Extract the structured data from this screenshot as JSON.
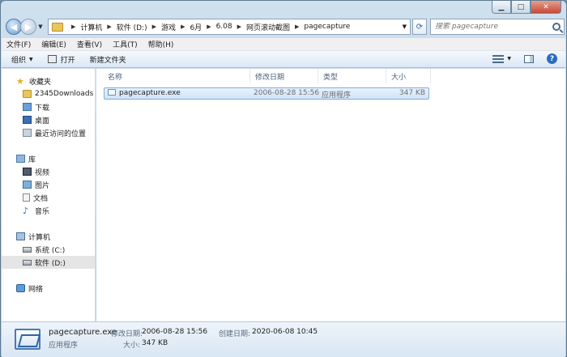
{
  "address_bar": {
    "breadcrumbs": [
      "计算机",
      "软件 (D:)",
      "游戏",
      "6月",
      "6.08",
      "网页滚动截图",
      "pagecapture"
    ]
  },
  "search": {
    "placeholder": "搜索 pagecapture"
  },
  "menu": [
    "文件(F)",
    "编辑(E)",
    "查看(V)",
    "工具(T)",
    "帮助(H)"
  ],
  "toolbar": {
    "organize": "组织",
    "open": "打开",
    "new_folder": "新建文件夹"
  },
  "nav": {
    "favorites": "收藏夹",
    "fav_items": [
      "2345Downloads",
      "下载",
      "桌面",
      "最近访问的位置"
    ],
    "libraries": "库",
    "lib_items": [
      "视频",
      "图片",
      "文档",
      "音乐"
    ],
    "computer": "计算机",
    "drives": [
      "系统 (C:)",
      "软件 (D:)"
    ],
    "network": "网络"
  },
  "columns": {
    "name": "名称",
    "date": "修改日期",
    "type": "类型",
    "size": "大小"
  },
  "files": [
    {
      "name": "pagecapture.exe",
      "date": "2006-08-28 15:56",
      "type": "应用程序",
      "size": "347 KB"
    }
  ],
  "details": {
    "filename": "pagecapture.exe",
    "modified_label": "修改日期:",
    "modified_value": "2006-08-28 15:56",
    "created_label": "创建日期:",
    "created_value": "2020-06-08 10:45",
    "type": "应用程序",
    "size_label": "大小:",
    "size_value": "347 KB"
  }
}
